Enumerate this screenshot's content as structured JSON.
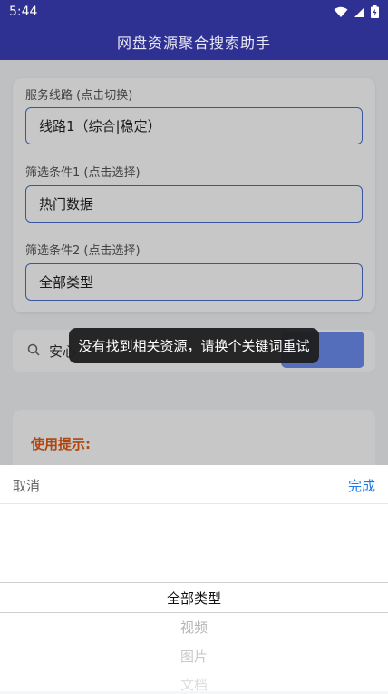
{
  "status": {
    "time": "5:44"
  },
  "app": {
    "title": "网盘资源聚合搜索助手"
  },
  "form": {
    "route_label": "服务线路 (点击切换)",
    "route_value": "线路1（综合|稳定）",
    "filter1_label": "筛选条件1 (点击选择)",
    "filter1_value": "热门数据",
    "filter2_label": "筛选条件2 (点击选择)",
    "filter2_value": "全部类型"
  },
  "search": {
    "value": "安心"
  },
  "tips": {
    "title": "使用提示:"
  },
  "toast": {
    "message": "没有找到相关资源，请换个关键词重试"
  },
  "picker": {
    "cancel_label": "取消",
    "done_label": "完成",
    "selected": "全部类型",
    "options": [
      "视频",
      "图片",
      "文档"
    ]
  },
  "colors": {
    "header": "#2e3192",
    "accent": "#1a7ae6",
    "tips_title": "#e05a14",
    "field_border": "#4b6fd0"
  }
}
